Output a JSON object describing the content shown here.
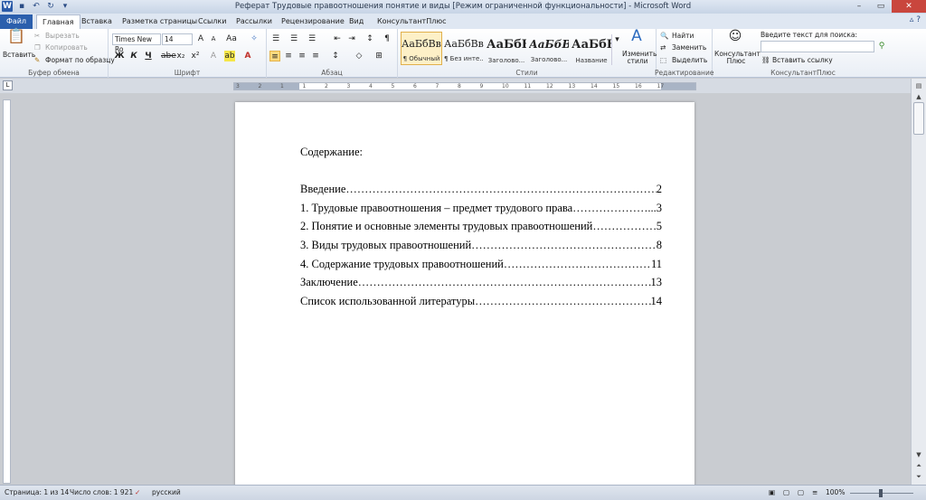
{
  "window": {
    "title": "Реферат Трудовые правоотношения понятие и виды [Режим ограниченной функциональности]  -  Microsoft Word",
    "qa_icons": [
      "word-logo-icon",
      "save-icon",
      "undo-icon",
      "redo-icon",
      "customize-icon"
    ]
  },
  "tabs": [
    "Файл",
    "Главная",
    "Вставка",
    "Разметка страницы",
    "Ссылки",
    "Рассылки",
    "Рецензирование",
    "Вид",
    "КонсультантПлюс"
  ],
  "ribbon": {
    "clipboard": {
      "paste": "Вставить",
      "cut": "Вырезать",
      "copy": "Копировать",
      "format_painter": "Формат по образцу",
      "label": "Буфер обмена"
    },
    "font": {
      "family": "Times New Ro",
      "size": "14",
      "label": "Шрифт",
      "bold": "Ж",
      "italic": "К",
      "underline": "Ч"
    },
    "paragraph": {
      "label": "Абзац"
    },
    "styles": {
      "label": "Стили",
      "items": [
        {
          "sample": "АаБбВвI",
          "name": "¶ Обычный"
        },
        {
          "sample": "АаБбВвI",
          "name": "¶ Без инте..."
        },
        {
          "sample": "АаБбЕ",
          "name": "Заголово..."
        },
        {
          "sample": "АаБбВ",
          "name": "Заголово..."
        },
        {
          "sample": "АаБбЕ",
          "name": "Название"
        }
      ],
      "change": "Изменить стили"
    },
    "editing": {
      "label": "Редактирование",
      "find": "Найти",
      "replace": "Заменить",
      "select": "Выделить"
    },
    "consultant": {
      "button": "Консультант Плюс",
      "search_label": "Введите текст для поиска:",
      "search_value": "",
      "insert_link": "Вставить ссылку",
      "label": "КонсультантПлюс"
    }
  },
  "ruler": {
    "ticks": [
      "3",
      "2",
      "1",
      "1",
      "2",
      "3",
      "4",
      "5",
      "6",
      "7",
      "8",
      "9",
      "10",
      "11",
      "12",
      "13",
      "14",
      "15",
      "16",
      "17"
    ]
  },
  "document": {
    "heading": "Содержание:",
    "toc": [
      {
        "title": "Введение",
        "page": "2"
      },
      {
        "title": "1. Трудовые правоотношения – предмет трудового права",
        "page": "...3"
      },
      {
        "title": "2. Понятие и основные элементы трудовых правоотношений",
        "page": "5"
      },
      {
        "title": "3. Виды трудовых правоотношений",
        "page": "8"
      },
      {
        "title": "4. Содержание трудовых правоотношений",
        "page": "11"
      },
      {
        "title": "Заключение",
        "page": "13"
      },
      {
        "title": "Список использованной литературы",
        "page": "14"
      }
    ]
  },
  "status": {
    "page": "Страница: 1 из 14",
    "words": "Число слов: 1 921",
    "language": "русский",
    "zoom": "100%"
  }
}
